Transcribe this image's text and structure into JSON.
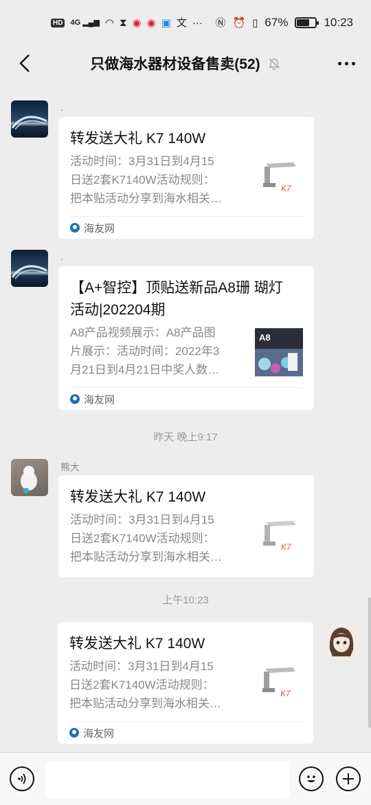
{
  "status_bar": {
    "hd_badge": "HD",
    "signal_label": "4G",
    "battery_percent": "67%",
    "battery_level": 0.67,
    "time": "10:23"
  },
  "header": {
    "title": "只做海水器材设备售卖(52)"
  },
  "messages": [
    {
      "nickname": ".",
      "card": {
        "title": "转发送大礼 K7 140W",
        "desc_lines": [
          "活动时间：3月31日到4月15",
          "日送2套K7140W活动规则：",
          "把本贴活动分享到海水相关…"
        ],
        "source": "海友网"
      }
    },
    {
      "nickname": ".",
      "card": {
        "title_lines": [
          "【A+智控】顶贴送新品A8珊 瑚灯",
          "活动|202204期"
        ],
        "desc_lines": [
          "A8产品视频展示：A8产品图",
          "片展示：活动时间：2022年3",
          "月21日到4月21日中奖人数…"
        ],
        "thumb_label": "A8",
        "source": "海友网"
      }
    },
    {
      "nickname": "熊大",
      "card": {
        "title": "转发送大礼 K7 140W",
        "desc_lines": [
          "活动时间：3月31日到4月15",
          "日送2套K7140W活动规则：",
          "把本贴活动分享到海水相关…"
        ]
      }
    },
    {
      "card": {
        "title": "转发送大礼 K7 140W",
        "desc_lines": [
          "活动时间：3月31日到4月15",
          "日送2套K7140W活动规则：",
          "把本贴活动分享到海水相关…"
        ],
        "source": "海友网"
      }
    }
  ],
  "timestamps": {
    "yesterday": "昨天 晚上9:17",
    "today": "上午10:23"
  },
  "icons": {
    "back": "chevron-left-icon",
    "mute": "bell-off-icon",
    "more": "more-dots-icon",
    "voice": "voice-icon",
    "emoji": "emoji-icon",
    "add": "plus-icon"
  }
}
